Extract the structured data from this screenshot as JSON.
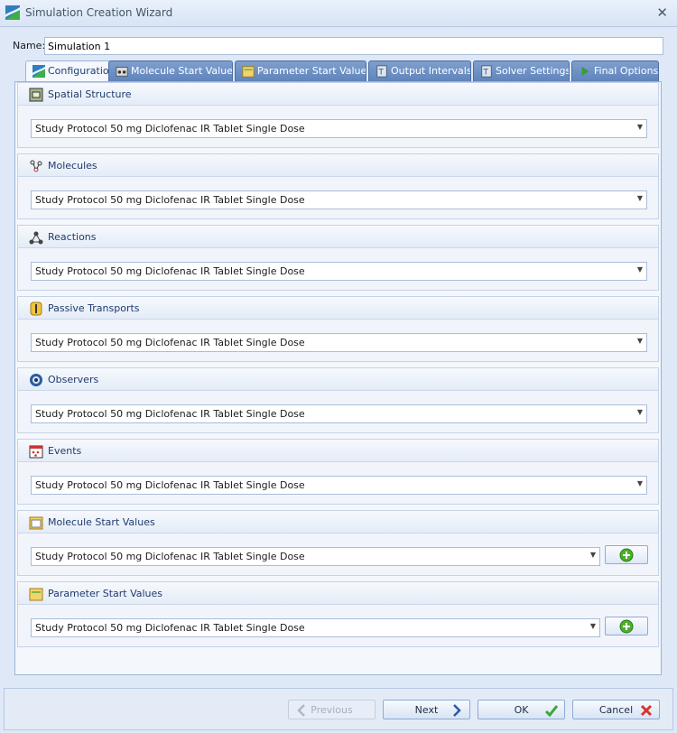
{
  "window": {
    "title": "Simulation Creation Wizard"
  },
  "name_field": {
    "label": "Name:",
    "value": "Simulation 1"
  },
  "tabs": [
    {
      "label": "Configuration",
      "icon": "configuration-icon",
      "active": true
    },
    {
      "label": "Molecule Start Values",
      "icon": "molecule-start-values-icon"
    },
    {
      "label": "Parameter Start Values",
      "icon": "parameter-start-values-icon"
    },
    {
      "label": "Output Intervals",
      "icon": "output-intervals-icon"
    },
    {
      "label": "Solver Settings",
      "icon": "solver-settings-icon"
    },
    {
      "label": "Final Options",
      "icon": "final-options-icon"
    }
  ],
  "groups": [
    {
      "title": "Spatial Structure",
      "icon": "spatial-structure-icon",
      "selected": "Study Protocol 50 mg Diclofenac IR Tablet Single Dose"
    },
    {
      "title": "Molecules",
      "icon": "molecules-icon",
      "selected": "Study Protocol 50 mg Diclofenac IR Tablet Single Dose"
    },
    {
      "title": "Reactions",
      "icon": "reactions-icon",
      "selected": "Study Protocol 50 mg Diclofenac IR Tablet Single Dose"
    },
    {
      "title": "Passive Transports",
      "icon": "passive-transports-icon",
      "selected": "Study Protocol 50 mg Diclofenac IR Tablet Single Dose"
    },
    {
      "title": "Observers",
      "icon": "observers-icon",
      "selected": "Study Protocol 50 mg Diclofenac IR Tablet Single Dose"
    },
    {
      "title": "Events",
      "icon": "events-icon",
      "selected": "Study Protocol 50 mg Diclofenac IR Tablet Single Dose"
    },
    {
      "title": "Molecule Start Values",
      "icon": "molecule-start-values-icon",
      "selected": "Study Protocol 50 mg Diclofenac IR Tablet Single Dose",
      "has_add": true
    },
    {
      "title": "Parameter Start Values",
      "icon": "parameter-start-values-icon",
      "selected": "Study Protocol 50 mg Diclofenac IR Tablet Single Dose",
      "has_add": true
    }
  ],
  "buttons": {
    "previous": "Previous",
    "next": "Next",
    "ok": "OK",
    "cancel": "Cancel"
  },
  "colors": {
    "accent": "#5f84bd",
    "ok_check": "#3aa82f",
    "cancel_x": "#d9342b",
    "add_plus": "#4caf2a"
  }
}
